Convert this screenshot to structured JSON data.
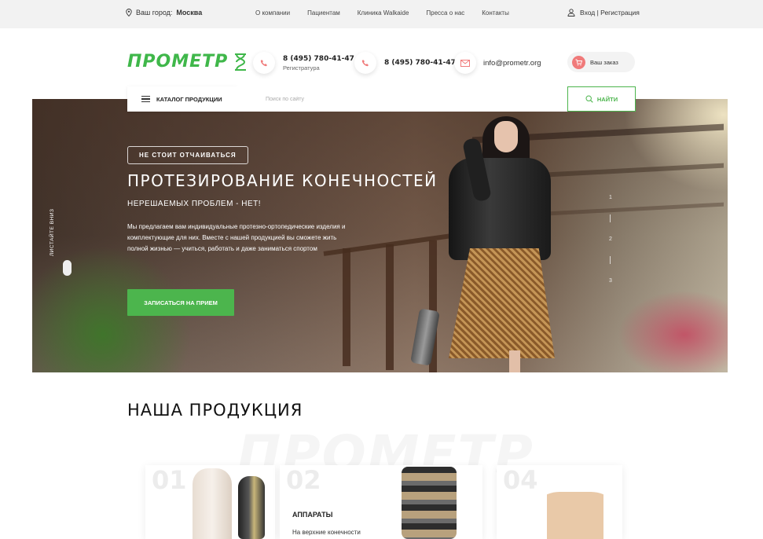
{
  "topbar": {
    "city_label": "Ваш город:",
    "city_value": "Москва",
    "nav": [
      "О компании",
      "Пациентам",
      "Клиника Walkaide",
      "Пресса о нас",
      "Контакты"
    ],
    "login": "Вход | Регистрация"
  },
  "header": {
    "logo": "ПРОМЕТР",
    "phone1": "8 (495) 780-41-47",
    "phone1_sub": "Регистратура",
    "phone2": "8 (495) 780-41-47",
    "email": "info@prometr.org",
    "order": "Ваш заказ"
  },
  "search": {
    "catalog": "КАТАЛОГ ПРОДУКЦИИ",
    "placeholder": "Поиск по сайту",
    "button": "НАЙТИ"
  },
  "hero": {
    "badge": "НЕ СТОИТ ОТЧАИВАТЬСЯ",
    "title": "ПРОТЕЗИРОВАНИЕ КОНЕЧНОСТЕЙ",
    "subtitle": "НЕРЕШАЕМЫХ ПРОБЛЕМ - НЕТ!",
    "text": "Мы предлагаем вам индивидуальные протезно-ортопедические изделия и комплектующие для них. Вместе с нашей продукцией вы сможете жить полной жизнью — учиться, работать и даже заниматься спортом",
    "cta": "ЗАПИСАТЬСЯ НА ПРИЕМ",
    "scroll": "ЛИСТАЙТЕ ВНИЗ",
    "slides": [
      "1",
      "2",
      "3"
    ]
  },
  "products": {
    "title": "НАША ПРОДУКЦИЯ",
    "watermark": "ПРОМЕТР",
    "cards": [
      {
        "num": "01",
        "name": "",
        "sub": ""
      },
      {
        "num": "02",
        "name": "АППАРАТЫ",
        "sub": "На верхние конечности"
      },
      {
        "num": "04",
        "name": "",
        "sub": ""
      }
    ]
  },
  "colors": {
    "accent": "#4cb54d",
    "order_icon": "#f07a7a",
    "topbar_bg": "#f2f2f2"
  }
}
